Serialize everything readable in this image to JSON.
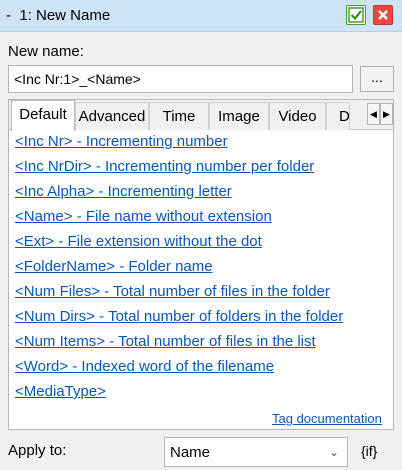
{
  "window": {
    "title": "-  1: New Name"
  },
  "new_name": {
    "label": "New name:",
    "value": "<Inc Nr:1>_<Name>",
    "browse_label": "..."
  },
  "tabs": [
    {
      "label": "Default",
      "active": true
    },
    {
      "label": "Advanced",
      "active": false
    },
    {
      "label": "Time",
      "active": false
    },
    {
      "label": "Image",
      "active": false
    },
    {
      "label": "Video",
      "active": false
    },
    {
      "label": "D",
      "active": false
    }
  ],
  "tags": [
    "<Inc Nr> - Incrementing number",
    "<Inc NrDir> - Incrementing number per folder",
    "<Inc Alpha> - Incrementing letter",
    "<Name> - File name without extension",
    "<Ext> - File extension without the dot",
    "<FolderName> - Folder name",
    "<Num Files> - Total number of files in the folder",
    "<Num Dirs> - Total number of folders in the folder",
    "<Num Items> - Total number of files in the list",
    "<Word> - Indexed word of the filename",
    "<MediaType>"
  ],
  "tag_documentation": "Tag documentation",
  "apply_to": {
    "label": "Apply to:",
    "value": "Name",
    "suffix": "{if}"
  },
  "icons": {
    "ok": "checkmark-icon",
    "close": "close-icon",
    "left": "scroll-left-icon",
    "right": "scroll-right-icon",
    "dropdown": "chevron-down-icon"
  }
}
